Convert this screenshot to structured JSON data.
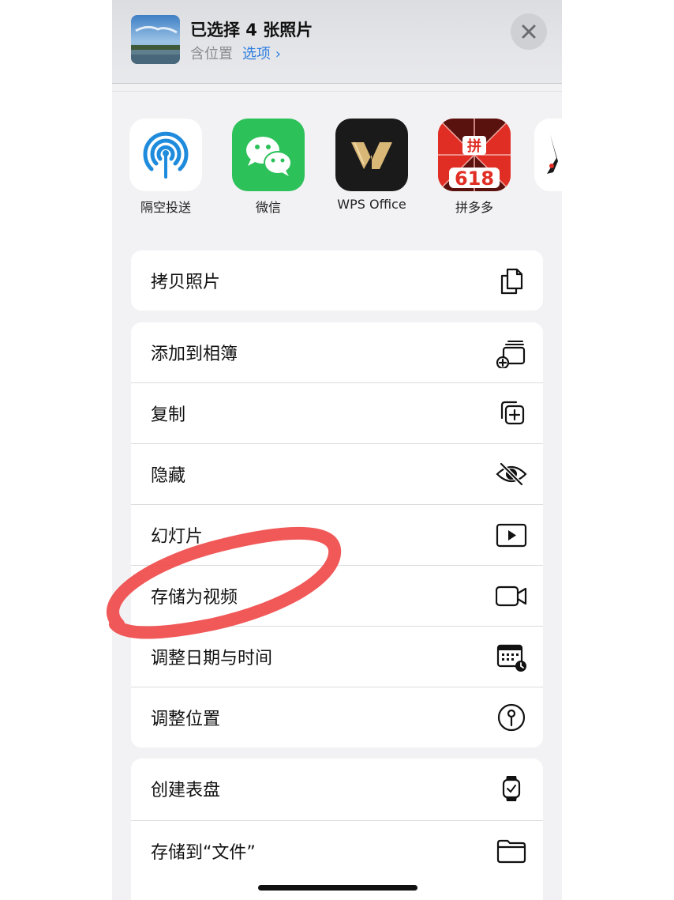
{
  "header": {
    "title": "已选择 4 张照片",
    "location_label": "含位置",
    "options_label": "选项",
    "options_chevron": "›"
  },
  "apps": [
    {
      "label": "隔空投送",
      "icon": "airdrop-icon"
    },
    {
      "label": "微信",
      "icon": "wechat-icon"
    },
    {
      "label": "WPS Office",
      "icon": "wps-office-icon"
    },
    {
      "label": "拼多多",
      "icon": "pinduoduo-icon"
    }
  ],
  "pdd_badge": "拼",
  "pdd_number": "618",
  "actions_group1": [
    {
      "label": "拷贝照片",
      "icon": "copy-photos-icon"
    }
  ],
  "actions_group2": [
    {
      "label": "添加到相簿",
      "icon": "add-to-album-icon"
    },
    {
      "label": "复制",
      "icon": "duplicate-icon"
    },
    {
      "label": "隐藏",
      "icon": "hide-eye-icon"
    },
    {
      "label": "幻灯片",
      "icon": "slideshow-icon"
    },
    {
      "label": "存储为视频",
      "icon": "video-camera-icon"
    },
    {
      "label": "调整日期与时间",
      "icon": "calendar-clock-icon"
    },
    {
      "label": "调整位置",
      "icon": "location-pin-icon"
    }
  ],
  "actions_group3": [
    {
      "label": "创建表盘",
      "icon": "watch-icon"
    },
    {
      "label": "存储到“文件”",
      "icon": "folder-icon"
    }
  ],
  "colors": {
    "accent": "#2f7fe0",
    "annotation": "#f04a4a",
    "sheet_bg": "#f2f2f4"
  }
}
